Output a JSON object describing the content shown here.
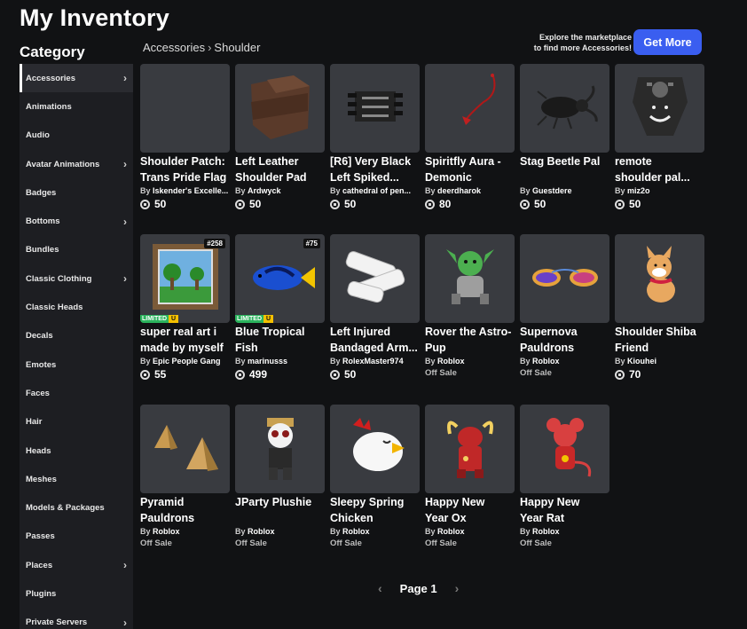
{
  "page_title": "My Inventory",
  "category_title": "Category",
  "breadcrumb": {
    "parent": "Accessories",
    "separator": "›",
    "current": "Shoulder"
  },
  "promo": {
    "line1": "Explore the marketplace",
    "line2": "to find more Accessories!",
    "button": "Get More",
    "button_color": "#3a5ef0"
  },
  "sidebar": [
    {
      "label": "Accessories",
      "chevron": true,
      "active": true
    },
    {
      "label": "Animations",
      "chevron": false
    },
    {
      "label": "Audio",
      "chevron": false
    },
    {
      "label": "Avatar Animations",
      "chevron": true
    },
    {
      "label": "Badges",
      "chevron": false
    },
    {
      "label": "Bottoms",
      "chevron": true
    },
    {
      "label": "Bundles",
      "chevron": false
    },
    {
      "label": "Classic Clothing",
      "chevron": true
    },
    {
      "label": "Classic Heads",
      "chevron": false
    },
    {
      "label": "Decals",
      "chevron": false
    },
    {
      "label": "Emotes",
      "chevron": false
    },
    {
      "label": "Faces",
      "chevron": false
    },
    {
      "label": "Hair",
      "chevron": false
    },
    {
      "label": "Heads",
      "chevron": false
    },
    {
      "label": "Meshes",
      "chevron": false
    },
    {
      "label": "Models & Packages",
      "chevron": false
    },
    {
      "label": "Passes",
      "chevron": false
    },
    {
      "label": "Places",
      "chevron": true
    },
    {
      "label": "Plugins",
      "chevron": false
    },
    {
      "label": "Private Servers",
      "chevron": true
    }
  ],
  "items": [
    {
      "name1": "Shoulder Patch:",
      "name2": "Trans Pride Flag",
      "by": "By",
      "creator": "Iskender's Excelle...",
      "price": "50",
      "icon": "blank-thumbnail"
    },
    {
      "name1": "Left Leather",
      "name2": "Shoulder Pad",
      "by": "By",
      "creator": "Ardwyck",
      "price": "50",
      "icon": "leather-pad-icon"
    },
    {
      "name1": "[R6] Very Black",
      "name2": "Left Spiked...",
      "by": "By",
      "creator": "cathedral of pen...",
      "price": "50",
      "icon": "spiked-pad-icon"
    },
    {
      "name1": "Spiritfly Aura -",
      "name2": "Demonic",
      "by": "By",
      "creator": "deerdharok",
      "price": "80",
      "icon": "spiritfly-icon"
    },
    {
      "name1": "Stag Beetle Pal",
      "name2": "",
      "by": "By",
      "creator": "Guestdere",
      "price": "50",
      "icon": "beetle-icon"
    },
    {
      "name1": "remote",
      "name2": "shoulder pal...",
      "by": "By",
      "creator": "miz2o",
      "price": "50",
      "icon": "remote-icon"
    },
    {
      "name1": "super real art i",
      "name2": "made by myself",
      "by": "By",
      "creator": "Epic People Gang",
      "price": "55",
      "icon": "painting-icon",
      "serial": "#258",
      "limited": "LIMITED",
      "limited_u": "U"
    },
    {
      "name1": "Blue Tropical",
      "name2": "Fish",
      "by": "By",
      "creator": "marinusss",
      "price": "499",
      "icon": "fish-icon",
      "serial": "#75",
      "limited": "LIMITED",
      "limited_u": "U"
    },
    {
      "name1": "Left Injured",
      "name2": "Bandaged Arm...",
      "by": "By",
      "creator": "RolexMaster974",
      "price": "50",
      "icon": "bandage-icon"
    },
    {
      "name1": "Rover the Astro-",
      "name2": "Pup",
      "by": "By",
      "creator": "Roblox",
      "offsale": "Off Sale",
      "icon": "astro-pup-icon"
    },
    {
      "name1": "Supernova",
      "name2": "Pauldrons",
      "by": "By",
      "creator": "Roblox",
      "offsale": "Off Sale",
      "icon": "supernova-icon"
    },
    {
      "name1": "Shoulder Shiba",
      "name2": "Friend",
      "by": "By",
      "creator": "Kiouhei",
      "price": "70",
      "icon": "shiba-icon"
    },
    {
      "name1": "Pyramid",
      "name2": "Pauldrons",
      "by": "By",
      "creator": "Roblox",
      "offsale": "Off Sale",
      "icon": "pyramid-icon"
    },
    {
      "name1": "JParty Plushie",
      "name2": "",
      "by": "By",
      "creator": "Roblox",
      "offsale": "Off Sale",
      "icon": "plushie-icon"
    },
    {
      "name1": "Sleepy Spring",
      "name2": "Chicken",
      "by": "By",
      "creator": "Roblox",
      "offsale": "Off Sale",
      "icon": "chicken-icon"
    },
    {
      "name1": "Happy New",
      "name2": "Year Ox",
      "by": "By",
      "creator": "Roblox",
      "offsale": "Off Sale",
      "icon": "ox-icon"
    },
    {
      "name1": "Happy New",
      "name2": "Year Rat",
      "by": "By",
      "creator": "Roblox",
      "offsale": "Off Sale",
      "icon": "rat-icon"
    }
  ],
  "pager": {
    "label": "Page 1",
    "prev": "‹",
    "next": "›"
  }
}
